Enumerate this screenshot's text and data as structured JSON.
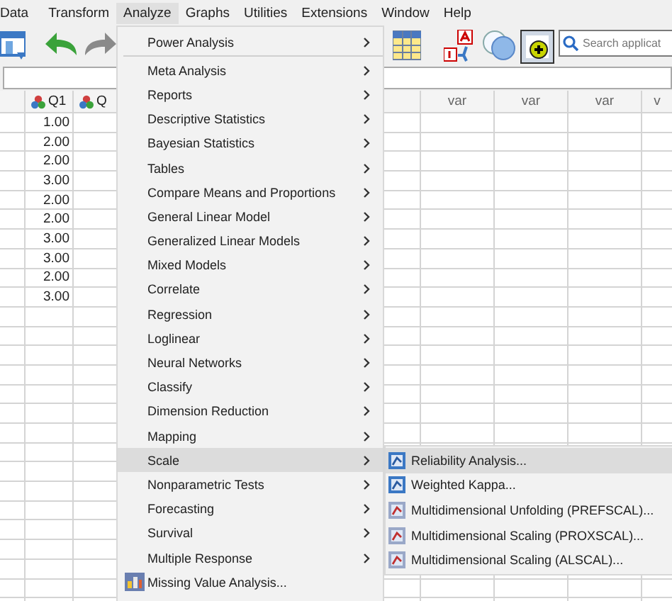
{
  "menubar": [
    {
      "label": "Data",
      "selected": false
    },
    {
      "label": "Transform",
      "selected": false
    },
    {
      "label": "Analyze",
      "selected": true
    },
    {
      "label": "Graphs",
      "selected": false
    },
    {
      "label": "Utilities",
      "selected": false
    },
    {
      "label": "Extensions",
      "selected": false
    },
    {
      "label": "Window",
      "selected": false
    },
    {
      "label": "Help",
      "selected": false
    }
  ],
  "search": {
    "placeholder": "Search applicat"
  },
  "grid": {
    "left_columns": [
      "Q1",
      "Q"
    ],
    "right_columns": [
      "var",
      "var",
      "var",
      "v"
    ],
    "rows": [
      "1.00",
      "2.00",
      "2.00",
      "3.00",
      "2.00",
      "2.00",
      "3.00",
      "3.00",
      "2.00",
      "3.00"
    ]
  },
  "menu": [
    {
      "label": "Power Analysis",
      "kind": "submenu",
      "highlighted": false,
      "separator_after": true
    },
    {
      "label": "Meta Analysis",
      "kind": "submenu",
      "highlighted": false
    },
    {
      "label": "Reports",
      "kind": "submenu",
      "highlighted": false
    },
    {
      "label": "Descriptive Statistics",
      "kind": "submenu",
      "highlighted": false
    },
    {
      "label": "Bayesian Statistics",
      "kind": "submenu",
      "highlighted": false
    },
    {
      "label": "Tables",
      "kind": "submenu",
      "highlighted": false
    },
    {
      "label": "Compare Means and Proportions",
      "kind": "submenu",
      "highlighted": false
    },
    {
      "label": "General Linear Model",
      "kind": "submenu",
      "highlighted": false
    },
    {
      "label": "Generalized Linear Models",
      "kind": "submenu",
      "highlighted": false
    },
    {
      "label": "Mixed Models",
      "kind": "submenu",
      "highlighted": false
    },
    {
      "label": "Correlate",
      "kind": "submenu",
      "highlighted": false
    },
    {
      "label": "Regression",
      "kind": "submenu",
      "highlighted": false
    },
    {
      "label": "Loglinear",
      "kind": "submenu",
      "highlighted": false
    },
    {
      "label": "Neural Networks",
      "kind": "submenu",
      "highlighted": false
    },
    {
      "label": "Classify",
      "kind": "submenu",
      "highlighted": false
    },
    {
      "label": "Dimension Reduction",
      "kind": "submenu",
      "highlighted": false
    },
    {
      "label": "Mapping",
      "kind": "submenu",
      "highlighted": false
    },
    {
      "label": "Scale",
      "kind": "submenu",
      "highlighted": true
    },
    {
      "label": "Nonparametric Tests",
      "kind": "submenu",
      "highlighted": false
    },
    {
      "label": "Forecasting",
      "kind": "submenu",
      "highlighted": false
    },
    {
      "label": "Survival",
      "kind": "submenu",
      "highlighted": false
    },
    {
      "label": "Multiple Response",
      "kind": "submenu",
      "highlighted": false
    },
    {
      "label": "Missing Value Analysis...",
      "kind": "action",
      "highlighted": false
    }
  ],
  "submenu": [
    {
      "label": "Reliability Analysis...",
      "highlighted": true
    },
    {
      "label": "Weighted Kappa...",
      "highlighted": false
    },
    {
      "label": "Multidimensional Unfolding (PREFSCAL)...",
      "highlighted": false
    },
    {
      "label": "Multidimensional Scaling (PROXSCAL)...",
      "highlighted": false
    },
    {
      "label": "Multidimensional Scaling (ALSCAL)...",
      "highlighted": false
    }
  ]
}
